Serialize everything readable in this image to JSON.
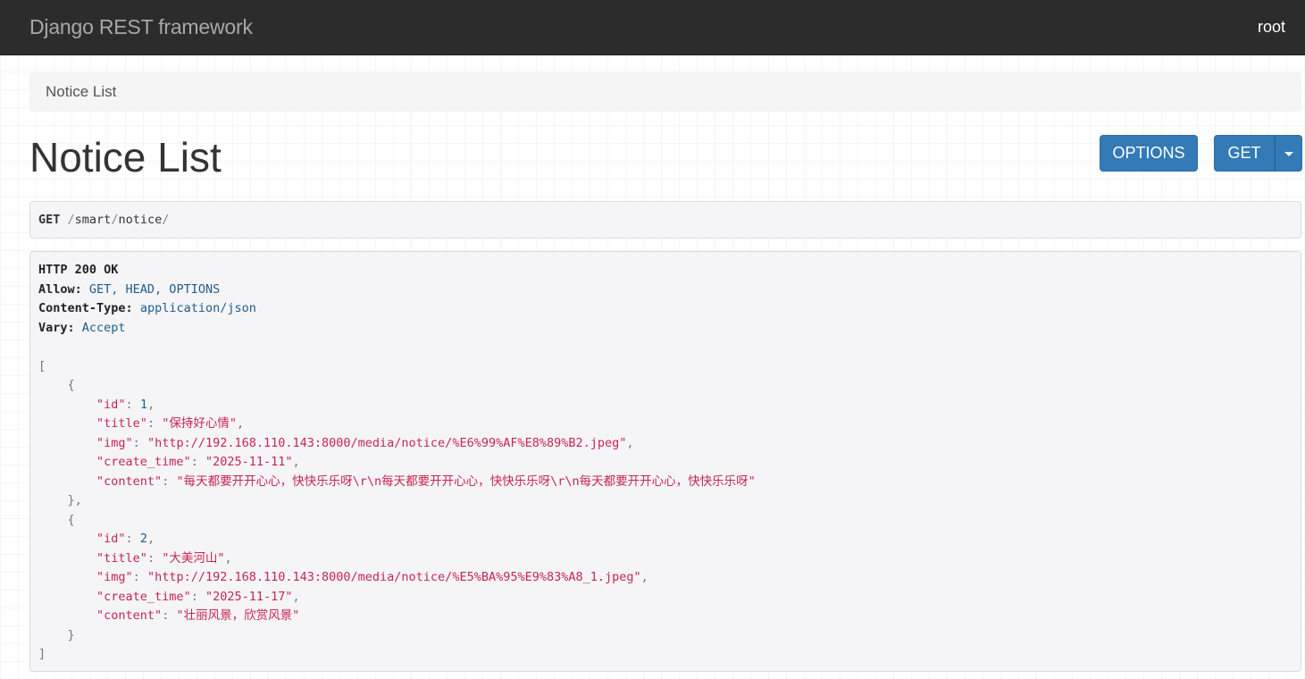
{
  "navbar": {
    "brand": "Django REST framework",
    "user": "root"
  },
  "breadcrumb": {
    "items": [
      "Notice List"
    ]
  },
  "page": {
    "title": "Notice List"
  },
  "buttons": {
    "options_label": "OPTIONS",
    "get_label": "GET"
  },
  "request": {
    "method": "GET",
    "path_segments": [
      "smart",
      "notice"
    ]
  },
  "response": {
    "status": "HTTP 200 OK",
    "headers": [
      {
        "key": "Allow",
        "value": "GET, HEAD, OPTIONS"
      },
      {
        "key": "Content-Type",
        "value": "application/json"
      },
      {
        "key": "Vary",
        "value": "Accept"
      }
    ],
    "body": [
      {
        "id": 1,
        "title": "保持好心情",
        "img": "http://192.168.110.143:8000/media/notice/%E6%99%AF%E8%89%B2.jpeg",
        "create_time": "2025-11-11",
        "content": "每天都要开开心心，快快乐乐呀\\r\\n每天都要开开心心，快快乐乐呀\\r\\n每天都要开开心心，快快乐乐呀"
      },
      {
        "id": 2,
        "title": "大美河山",
        "img": "http://192.168.110.143:8000/media/notice/%E5%BA%95%E9%83%A8_1.jpeg",
        "create_time": "2025-11-17",
        "content": "壮丽风景，欣赏风景"
      }
    ]
  },
  "colors": {
    "navbar_bg": "#2c2c2c",
    "button_primary": "#337ab7",
    "json_string": "#c7254e",
    "json_number": "#1f5c8a"
  }
}
